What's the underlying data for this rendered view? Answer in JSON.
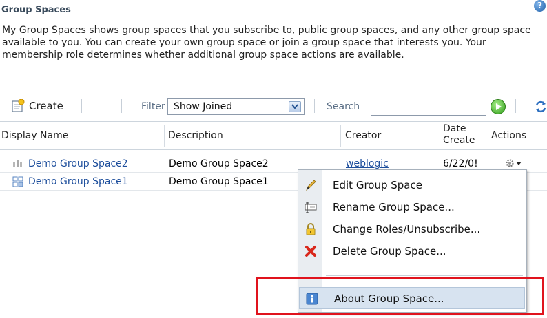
{
  "header": {
    "title": "Group Spaces",
    "help_glyph": "?",
    "description": "My Group Spaces shows group spaces that you subscribe to, public group spaces, and any other group space available to you. You can create your own group space or join a group space that interests you. Your membership role determines whether additional group space actions are available."
  },
  "toolbar": {
    "create_label": "Create",
    "filter_label": "Filter",
    "filter_value": "Show Joined",
    "search_label": "Search",
    "search_value": ""
  },
  "table": {
    "columns": [
      "Display Name",
      "Description",
      "Creator",
      "Date\nCreate",
      "Actions"
    ],
    "rows": [
      {
        "name": "Demo Group Space2",
        "description": "Demo Group Space2",
        "creator": "weblogic",
        "date": "6/22/0!"
      },
      {
        "name": "Demo Group Space1",
        "description": "Demo Group Space1",
        "creator": "",
        "date": ""
      }
    ]
  },
  "menu": {
    "items": [
      {
        "label": "Edit Group Space",
        "icon": "pencil-icon"
      },
      {
        "label": "Rename Group Space...",
        "icon": "rename-icon"
      },
      {
        "label": "Change Roles/Unsubscribe...",
        "icon": "lock-icon"
      },
      {
        "label": "Delete Group Space...",
        "icon": "delete-x-icon"
      },
      {
        "label": "About Group Space...",
        "icon": "info-icon"
      }
    ]
  },
  "colors": {
    "link": "#1d4e9c",
    "highlight": "#e0131d",
    "menu_highlight": "#d7e3f0"
  }
}
